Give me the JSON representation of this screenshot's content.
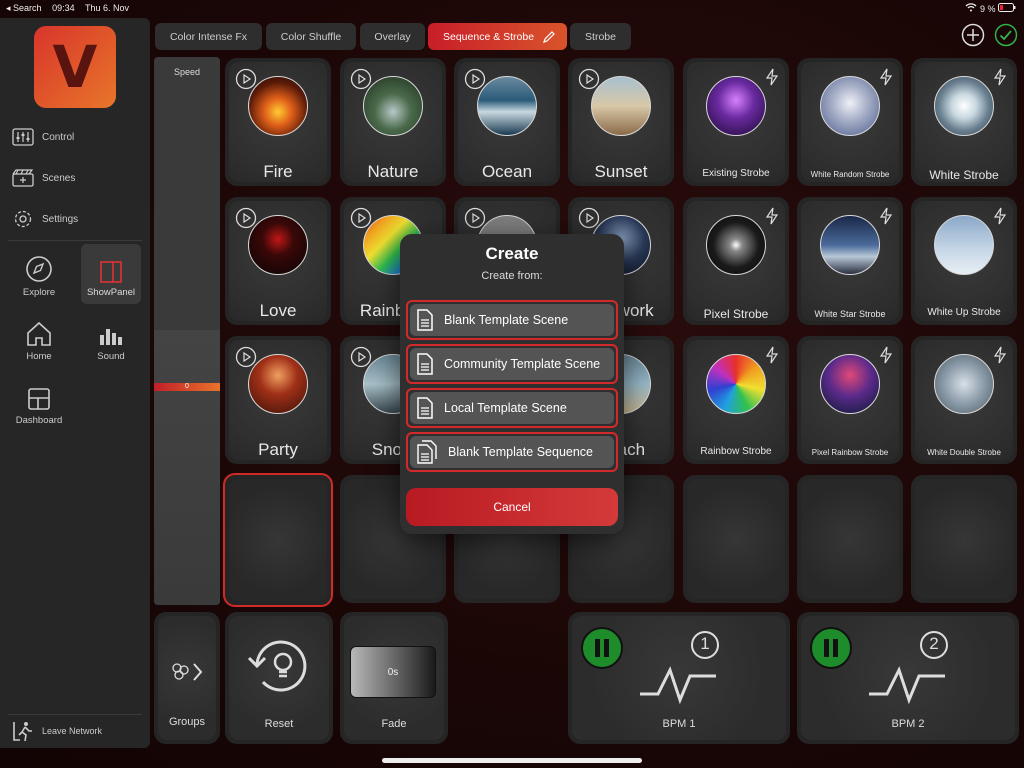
{
  "status": {
    "back": "◂ Search",
    "time": "09:34",
    "date": "Thu 6. Nov",
    "battery": "9 %"
  },
  "app": {
    "logo_letter": "V"
  },
  "sidebar": {
    "menu": [
      {
        "label": "Control",
        "icon": "sliders-icon"
      },
      {
        "label": "Scenes",
        "icon": "clapperboard-icon"
      },
      {
        "label": "Settings",
        "icon": "gear-icon"
      }
    ],
    "grid": [
      {
        "label": "Explore",
        "icon": "compass-icon"
      },
      {
        "label": "ShowPanel",
        "icon": "panel-icon"
      },
      {
        "label": "Home",
        "icon": "house-icon"
      },
      {
        "label": "Sound",
        "icon": "bars-icon"
      },
      {
        "label": "Dashboard",
        "icon": "dashboard-icon"
      }
    ],
    "leave": "Leave Network"
  },
  "tabs": [
    "Color Intense Fx",
    "Color Shuffle",
    "Overlay",
    "Sequence & Strobe",
    "Strobe"
  ],
  "active_tab": "Sequence & Strobe",
  "speed": {
    "label": "Speed",
    "value": "0"
  },
  "tiles": [
    {
      "name": "Fire",
      "type": "sequence"
    },
    {
      "name": "Nature",
      "type": "sequence"
    },
    {
      "name": "Ocean",
      "type": "sequence"
    },
    {
      "name": "Sunset",
      "type": "sequence"
    },
    {
      "name": "Existing Strobe",
      "type": "strobe"
    },
    {
      "name": "White Random Strobe",
      "type": "strobe"
    },
    {
      "name": "White Strobe",
      "type": "strobe"
    },
    {
      "name": "Love",
      "type": "sequence"
    },
    {
      "name": "Rainbow",
      "type": "sequence"
    },
    {
      "name": "",
      "type": "sequence"
    },
    {
      "name": "Firework",
      "type": "sequence"
    },
    {
      "name": "Pixel Strobe",
      "type": "strobe"
    },
    {
      "name": "White Star Strobe",
      "type": "strobe"
    },
    {
      "name": "White Up Strobe",
      "type": "strobe"
    },
    {
      "name": "Party",
      "type": "sequence"
    },
    {
      "name": "Snow",
      "type": "sequence"
    },
    {
      "name": "",
      "type": "sequence"
    },
    {
      "name": "Beach",
      "type": "sequence"
    },
    {
      "name": "Rainbow Strobe",
      "type": "strobe"
    },
    {
      "name": "Pixel Rainbow Strobe",
      "type": "strobe"
    },
    {
      "name": "White Double Strobe",
      "type": "strobe"
    }
  ],
  "bottom": {
    "groups": "Groups",
    "reset": "Reset",
    "fade": "Fade",
    "fade_value": "0s",
    "bpm1": {
      "label": "BPM 1",
      "number": "1"
    },
    "bpm2": {
      "label": "BPM 2",
      "number": "2"
    }
  },
  "modal": {
    "title": "Create",
    "subtitle": "Create from:",
    "options": [
      "Blank Template Scene",
      "Community Template Scene",
      "Local Template Scene",
      "Blank Template Sequence"
    ],
    "cancel": "Cancel"
  },
  "colors": {
    "accent": "#d22a2a",
    "play_green": "#1e8c2a"
  }
}
